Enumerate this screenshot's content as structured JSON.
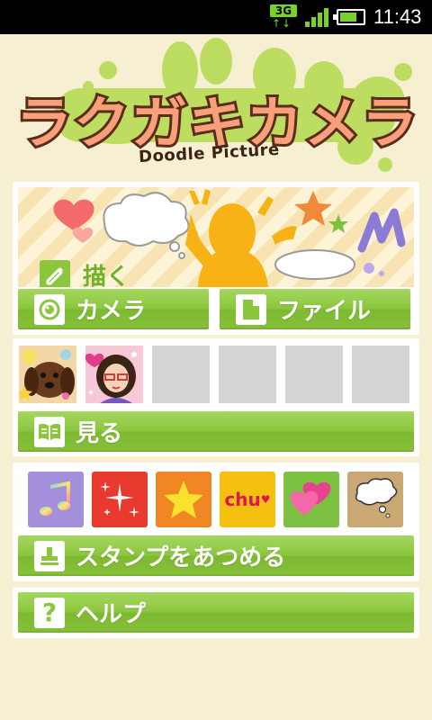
{
  "status_bar": {
    "network": "3G",
    "network_arrows": "↑↓",
    "time": "11:43",
    "battery_level": 0.6
  },
  "header": {
    "title": "ラクガキカメラ",
    "subtitle": "Doodle Picture"
  },
  "main_menu": {
    "draw_label": "描く",
    "camera_label": "カメラ",
    "file_label": "ファイル"
  },
  "gallery": {
    "view_label": "見る",
    "filled_slots": 2,
    "total_slots": 6
  },
  "stamps": {
    "collect_label": "スタンプをあつめる",
    "items": [
      {
        "name": "music-note",
        "color": "#a48fdc"
      },
      {
        "name": "sparkles",
        "color": "#e8392e"
      },
      {
        "name": "star",
        "color": "#f08624"
      },
      {
        "name": "chu",
        "text": "chu",
        "color": "#f6c012"
      },
      {
        "name": "hearts",
        "color": "#7cc142"
      },
      {
        "name": "speech-bubble",
        "color": "#c9a874"
      }
    ]
  },
  "help": {
    "label": "ヘルプ",
    "icon": "question-icon"
  },
  "colors": {
    "background": "#f7efd2",
    "button_green": "#8cc63f",
    "title_outline": "#5a2c1c"
  }
}
